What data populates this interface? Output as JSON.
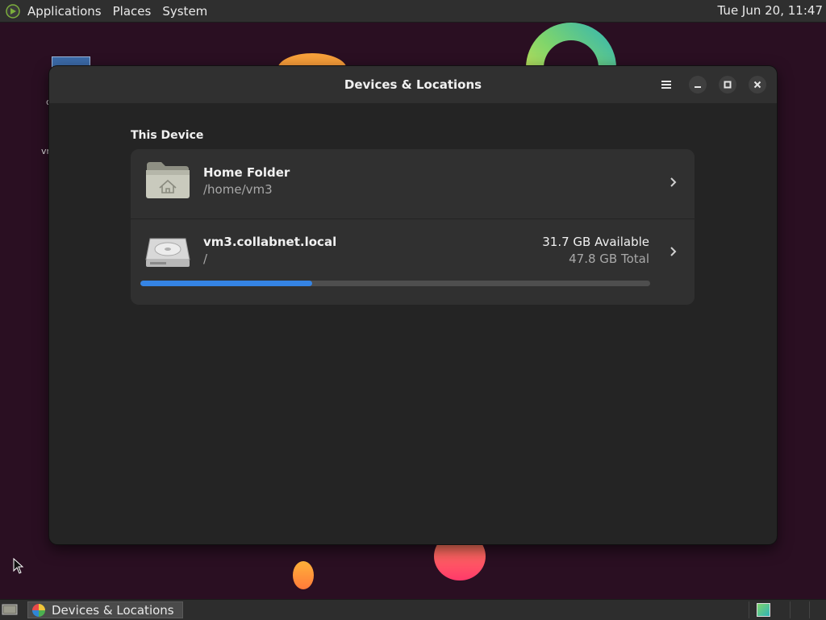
{
  "top_panel": {
    "menus": [
      "Applications",
      "Places",
      "System"
    ],
    "clock": "Tue Jun 20, 11:47"
  },
  "desktop": {
    "icon_label_partial": "vr",
    "icon_glyph_partial": "c"
  },
  "window": {
    "title": "Devices & Locations",
    "section_title": "This Device",
    "home": {
      "name": "Home Folder",
      "path": "/home/vm3"
    },
    "disk": {
      "name": "vm3.collabnet.local",
      "mount": "/",
      "available": "31.7 GB Available",
      "total": "47.8 GB Total",
      "used_fraction": 0.337
    }
  },
  "taskbar": {
    "task_label": "Devices & Locations"
  },
  "colors": {
    "accent": "#3584e4",
    "window_bg": "#242424",
    "list_bg": "#303030"
  }
}
